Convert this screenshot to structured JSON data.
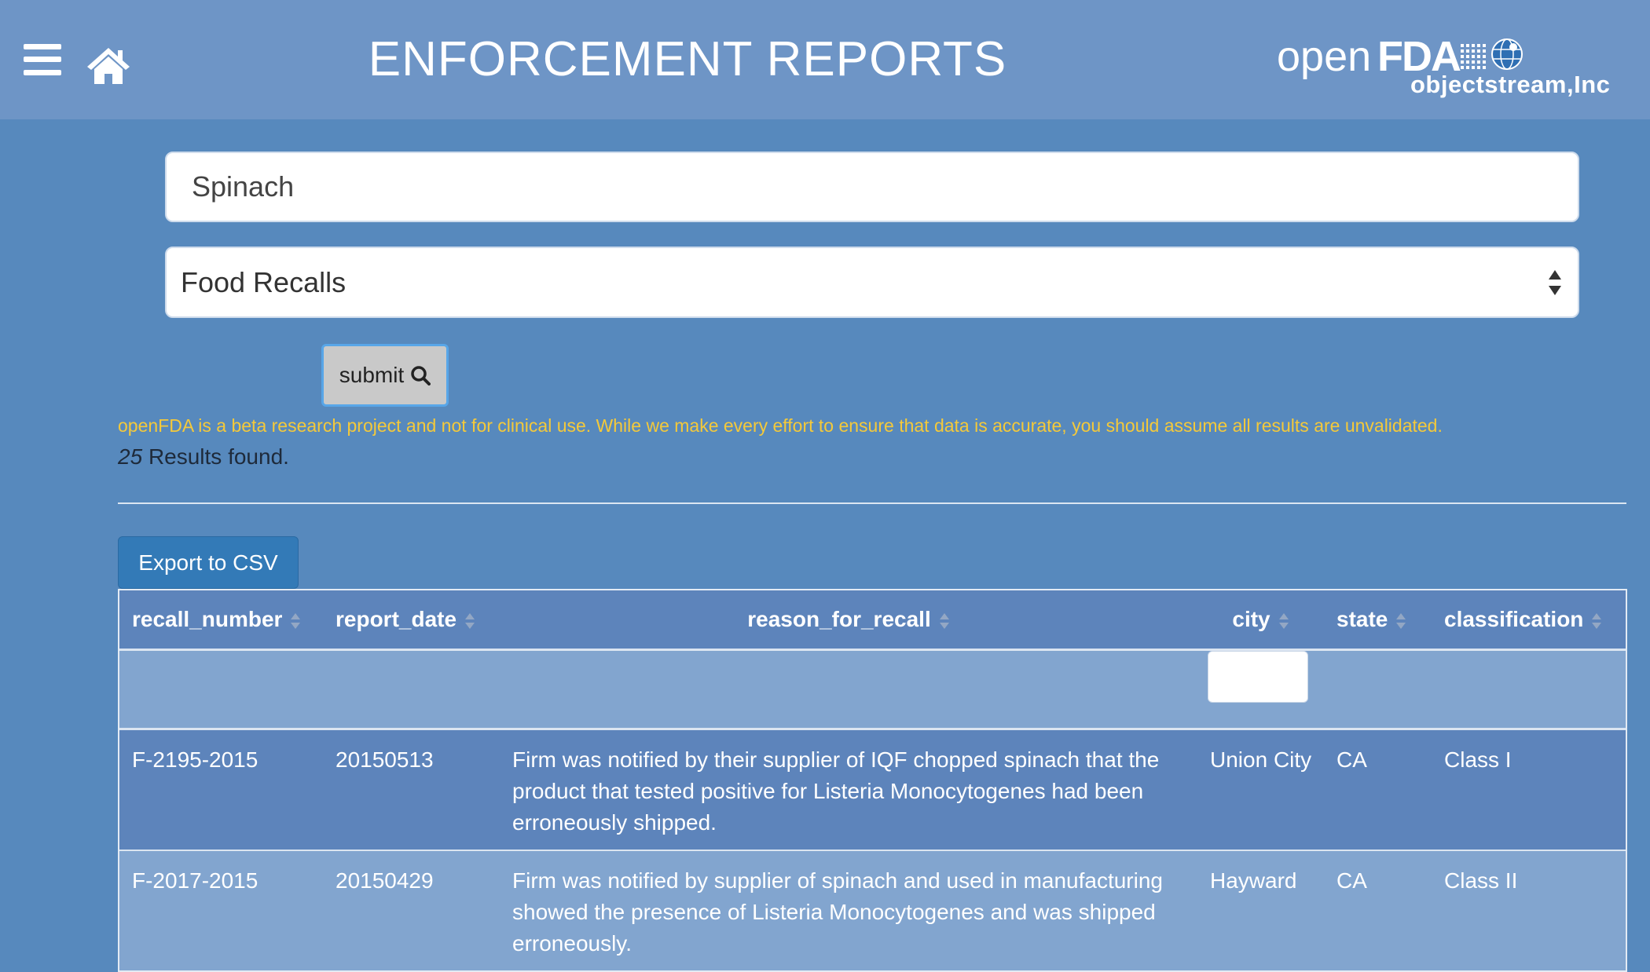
{
  "header": {
    "title": "ENFORCEMENT REPORTS",
    "logo": {
      "brand_open": "open",
      "brand_fda": "FDA",
      "company": "objectstream,Inc"
    }
  },
  "search": {
    "value": "Spinach",
    "placeholder": ""
  },
  "report_type": {
    "selected": "Food Recalls"
  },
  "submit": {
    "label": "submit",
    "icon": "search-icon"
  },
  "disclaimer": "openFDA is a beta research project and not for clinical use. While we make every effort to ensure that data is accurate, you should assume all results are unvalidated.",
  "results": {
    "count": "25",
    "label": "Results found."
  },
  "export": {
    "label": "Export to CSV"
  },
  "table": {
    "columns": [
      "recall_number",
      "report_date",
      "reason_for_recall",
      "city",
      "state",
      "classification"
    ],
    "city_filter_value": "",
    "rows": [
      {
        "recall_number": "F-2195-2015",
        "report_date": "20150513",
        "reason_for_recall": "Firm was notified by their supplier of IQF chopped spinach that the product that tested positive for Listeria Monocytogenes had been erroneously shipped.",
        "city": "Union City",
        "state": "CA",
        "classification": "Class I"
      },
      {
        "recall_number": "F-2017-2015",
        "report_date": "20150429",
        "reason_for_recall": "Firm was notified by supplier of spinach and used in manufacturing showed the presence of Listeria Monocytogenes and was shipped erroneously.",
        "city": "Hayward",
        "state": "CA",
        "classification": "Class II"
      }
    ]
  },
  "colors": {
    "background": "#5789bd",
    "topbar": "#6e95c6",
    "header_row": "#5d84bb",
    "alt_row": "#82a5cf",
    "disclaimer": "#f4c93a",
    "export_button": "#337ab7",
    "submit_button": "#c9c9c9"
  }
}
